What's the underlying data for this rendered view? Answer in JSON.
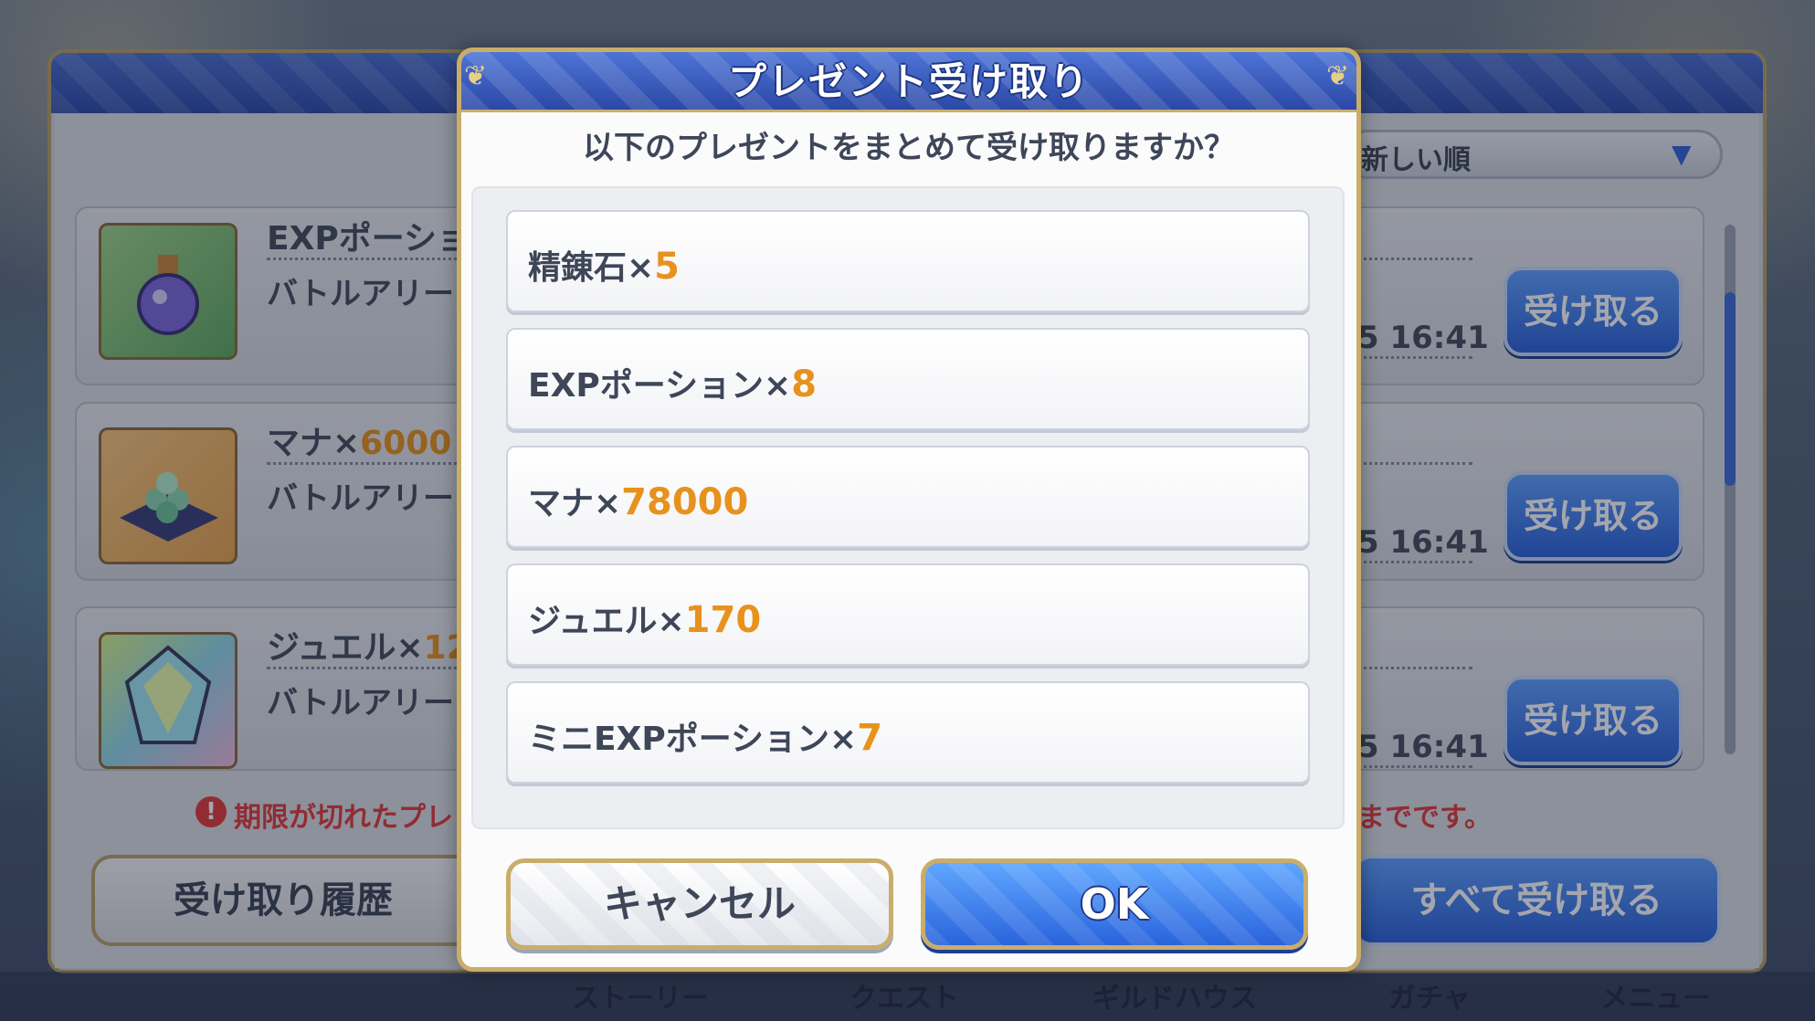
{
  "background": {
    "sort": {
      "label": "新しい順",
      "arrow_icon": "triangle-down-icon"
    },
    "rows": [
      {
        "title_prefix": "EXPポーショ",
        "title_qty": "",
        "subtitle": "バトルアリー",
        "date": "5 16:41",
        "button": "受け取る",
        "icon": "potion-icon"
      },
      {
        "title_prefix": "マナ×",
        "title_qty": "6000",
        "subtitle": "バトルアリー",
        "date": "5 16:41",
        "button": "受け取る",
        "icon": "mana-icon"
      },
      {
        "title_prefix": "ジュエル×",
        "title_qty": "12",
        "subtitle": "バトルアリー",
        "date": "5 16:41",
        "button": "受け取る",
        "icon": "jewel-icon"
      }
    ],
    "warning_text": "期限が切れたプレ",
    "warning_tail": "までです。",
    "history_button": "受け取り履歴",
    "receive_all_button": "すべて受け取る",
    "nav": [
      "ストーリー",
      "クエスト",
      "ギルドハウス",
      "ガチャ",
      "メニュー"
    ]
  },
  "dialog": {
    "title": "プレゼント受け取り",
    "question": "以下のプレゼントをまとめて受け取りますか？",
    "items": [
      {
        "name": "精錬石×",
        "qty": "5"
      },
      {
        "name": "EXPポーション×",
        "qty": "8"
      },
      {
        "name": "マナ×",
        "qty": "78000"
      },
      {
        "name": "ジュエル×",
        "qty": "170"
      },
      {
        "name": "ミニEXPポーション×",
        "qty": "7"
      }
    ],
    "cancel_label": "キャンセル",
    "ok_label": "OK"
  },
  "colors": {
    "accent_blue": "#2c62d8",
    "quantity_orange": "#e7921c",
    "gold_border": "#c9ad6a",
    "warning_red": "#e33a3a"
  }
}
